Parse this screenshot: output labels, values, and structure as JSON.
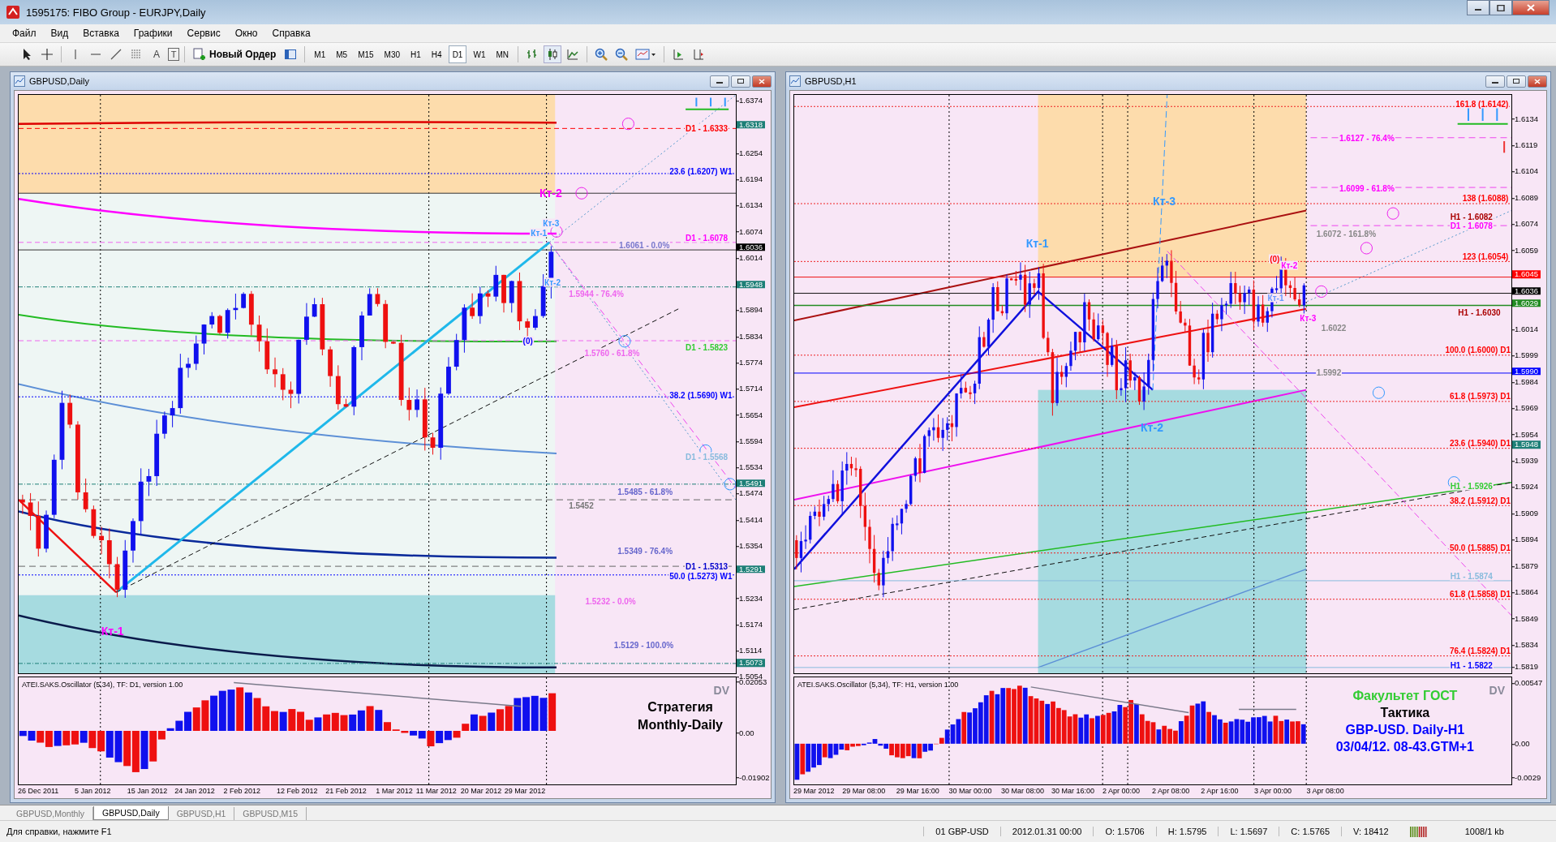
{
  "window": {
    "title": "1595175: FIBO Group - EURJPY,Daily"
  },
  "menu": [
    "Файл",
    "Вид",
    "Вставка",
    "Графики",
    "Сервис",
    "Окно",
    "Справка"
  ],
  "toolbar": {
    "text_tools": [
      "A",
      "T"
    ],
    "new_order": "Новый Ордер",
    "timeframes": [
      {
        "label": "M1",
        "selected": false
      },
      {
        "label": "M5",
        "selected": false
      },
      {
        "label": "M15",
        "selected": false
      },
      {
        "label": "M30",
        "selected": false
      },
      {
        "label": "H1",
        "selected": false
      },
      {
        "label": "H4",
        "selected": false
      },
      {
        "label": "D1",
        "selected": true
      },
      {
        "label": "W1",
        "selected": false
      },
      {
        "label": "MN",
        "selected": false
      }
    ]
  },
  "charts": [
    {
      "title": "GBPUSD,Daily",
      "price_axis": [
        "1.6374",
        "1.6254",
        "1.6194",
        "1.6134",
        "1.6074",
        "1.6014",
        "1.5894",
        "1.5834",
        "1.5774",
        "1.5714",
        "1.5654",
        "1.5594",
        "1.5534",
        "1.5474",
        "1.5414",
        "1.5354",
        "1.5234",
        "1.5174",
        "1.5114",
        "1.5054"
      ],
      "price_tags": [
        {
          "text": "1.6318",
          "color": "#1d7f77"
        },
        {
          "text": "1.6036",
          "color": "#000000"
        },
        {
          "text": "1.5948",
          "color": "#1d7f77"
        },
        {
          "text": "1.5491",
          "color": "#1d7f77"
        },
        {
          "text": "1.5291",
          "color": "#1d7f77"
        },
        {
          "text": "1.5073",
          "color": "#1d7f77"
        }
      ],
      "labels": [
        {
          "text": "D1 - 1.6333",
          "color": "#ff0000",
          "kind": "level"
        },
        {
          "text": "23.6 (1.6207) W1",
          "color": "#0000ff",
          "kind": "level"
        },
        {
          "text": "Кт-2",
          "color": "#ff00ff",
          "kind": "wave"
        },
        {
          "text": "Кт-3",
          "color": "#3399ff",
          "kind": "level"
        },
        {
          "text": "Кт-1",
          "color": "#3399ff",
          "kind": "level"
        },
        {
          "text": "D1 - 1.6078",
          "color": "#ff00ff",
          "kind": "level"
        },
        {
          "text": "1.6061 - 0.0%",
          "color": "#7777cc",
          "kind": "level"
        },
        {
          "text": "Кт-2",
          "color": "#3399ff",
          "kind": "level"
        },
        {
          "text": "1.5944 - 76.4%",
          "color": "#ee66ee",
          "kind": "level"
        },
        {
          "text": "(0)",
          "color": "#0000ff",
          "kind": "level"
        },
        {
          "text": "D1 - 1.5823",
          "color": "#33cc33",
          "kind": "level"
        },
        {
          "text": "1.5760 - 61.8%",
          "color": "#ee66ee",
          "kind": "level"
        },
        {
          "text": "38.2 (1.5690) W1",
          "color": "#0000ff",
          "kind": "level"
        },
        {
          "text": "D1 - 1.5568",
          "color": "#88bbdd",
          "kind": "level"
        },
        {
          "text": "1.5485 - 61.8%",
          "color": "#6666cc",
          "kind": "level"
        },
        {
          "text": "1.5452",
          "color": "#777777",
          "kind": "level"
        },
        {
          "text": "1.5349 - 76.4%",
          "color": "#6666cc",
          "kind": "level"
        },
        {
          "text": "D1 - 1.5313",
          "color": "#0000cc",
          "kind": "level"
        },
        {
          "text": "50.0 (1.5273) W1",
          "color": "#0000ff",
          "kind": "level"
        },
        {
          "text": "1.5232 - 0.0%",
          "color": "#ee66ee",
          "kind": "level"
        },
        {
          "text": "Кт-1",
          "color": "#ff00ff",
          "kind": "wave"
        },
        {
          "text": "1.5129 - 100.0%",
          "color": "#6666cc",
          "kind": "level"
        }
      ],
      "oscillator": {
        "title": "ATEI.SAKS.Oscillator (5,34), TF: D1, version 1.00",
        "badge": "DV",
        "axis": [
          "0.02053",
          "0.00",
          "-0.01902"
        ],
        "notes": [
          {
            "text": "Стратегия",
            "color": "#000000"
          },
          {
            "text": "Monthly-Daily",
            "color": "#000000"
          }
        ]
      },
      "dates": [
        "26 Dec 2011",
        "5 Jan 2012",
        "15 Jan 2012",
        "24 Jan 2012",
        "2 Feb 2012",
        "12 Feb 2012",
        "21 Feb 2012",
        "1 Mar 2012",
        "11 Mar 2012",
        "20 Mar 2012",
        "29 Mar 2012"
      ]
    },
    {
      "title": "GBPUSD,H1",
      "price_axis": [
        "1.6134",
        "1.6119",
        "1.6104",
        "1.6089",
        "1.6074",
        "1.6059",
        "1.6014",
        "1.5999",
        "1.5984",
        "1.5969",
        "1.5954",
        "1.5939",
        "1.5924",
        "1.5909",
        "1.5894",
        "1.5879",
        "1.5864",
        "1.5849",
        "1.5834",
        "1.5819"
      ],
      "price_tags": [
        {
          "text": "1.6045",
          "color": "#ff0000"
        },
        {
          "text": "1.6036",
          "color": "#000000"
        },
        {
          "text": "1.6029",
          "color": "#228b22"
        },
        {
          "text": "1.5990",
          "color": "#0000ff"
        },
        {
          "text": "1.5948",
          "color": "#1d7f77"
        }
      ],
      "labels": [
        {
          "text": "161.8 (1.6142)",
          "color": "#ff0000",
          "kind": "level"
        },
        {
          "text": "1.6127 - 76.4%",
          "color": "#ff00ff",
          "kind": "level"
        },
        {
          "text": "1.6099 - 61.8%",
          "color": "#ff00ff",
          "kind": "level"
        },
        {
          "text": "138 (1.6088)",
          "color": "#ff0000",
          "kind": "level"
        },
        {
          "text": "Кт-3",
          "color": "#3399ff",
          "kind": "wave"
        },
        {
          "text": "H1 - 1.6082",
          "color": "#aa0000",
          "kind": "level"
        },
        {
          "text": "D1 - 1.6078",
          "color": "#ff00ff",
          "kind": "level"
        },
        {
          "text": "1.6072 - 161.8%",
          "color": "#888888",
          "kind": "level"
        },
        {
          "text": "Кт-1",
          "color": "#3399ff",
          "kind": "wave"
        },
        {
          "text": "123 (1.6054)",
          "color": "#ff0000",
          "kind": "level"
        },
        {
          "text": "(0)",
          "color": "#ff0000",
          "kind": "level"
        },
        {
          "text": "Кт-2",
          "color": "#ff00ff",
          "kind": "level"
        },
        {
          "text": "Кт-1",
          "color": "#6699ff",
          "kind": "level"
        },
        {
          "text": "H1 - 1.6030",
          "color": "#aa0000",
          "kind": "level"
        },
        {
          "text": "Кт-3",
          "color": "#ff00ff",
          "kind": "level"
        },
        {
          "text": "1.6022",
          "color": "#888888",
          "kind": "level"
        },
        {
          "text": "100.0 (1.6000) D1",
          "color": "#ff0000",
          "kind": "level"
        },
        {
          "text": "1.5992",
          "color": "#888888",
          "kind": "level"
        },
        {
          "text": "61.8 (1.5973) D1",
          "color": "#ff0000",
          "kind": "level"
        },
        {
          "text": "Кт-2",
          "color": "#3399ff",
          "kind": "wave"
        },
        {
          "text": "23.6 (1.5940) D1",
          "color": "#ff0000",
          "kind": "level"
        },
        {
          "text": "H1 - 1.5926",
          "color": "#33cc33",
          "kind": "level"
        },
        {
          "text": "38.2 (1.5912) D1",
          "color": "#ff0000",
          "kind": "level"
        },
        {
          "text": "50.0 (1.5885) D1",
          "color": "#ff0000",
          "kind": "level"
        },
        {
          "text": "H1 - 1.5874",
          "color": "#88bbdd",
          "kind": "level"
        },
        {
          "text": "61.8 (1.5858) D1",
          "color": "#ff0000",
          "kind": "level"
        },
        {
          "text": "76.4 (1.5824) D1",
          "color": "#ff0000",
          "kind": "level"
        },
        {
          "text": "H1 - 1.5822",
          "color": "#0000ff",
          "kind": "level"
        }
      ],
      "oscillator": {
        "title": "ATEI.SAKS.Oscillator (5,34), TF: H1, version 1.00",
        "badge": "DV",
        "axis": [
          "0.00547",
          "0.00",
          "-0.0029"
        ],
        "notes": [
          {
            "text": "Факультет ГОСТ",
            "color": "#33cc33"
          },
          {
            "text": "Тактика",
            "color": "#000000"
          },
          {
            "text": "GBP-USD. Daily-H1",
            "color": "#0000ff"
          },
          {
            "text": "03/04/12. 08-43.GTM+1",
            "color": "#0000ff"
          }
        ]
      },
      "dates": [
        "29 Mar 2012",
        "29 Mar 08:00",
        "29 Mar 16:00",
        "30 Mar 00:00",
        "30 Mar 08:00",
        "30 Mar 16:00",
        "2 Apr 00:00",
        "2 Apr 08:00",
        "2 Apr 16:00",
        "3 Apr 00:00",
        "3 Apr 08:00"
      ]
    }
  ],
  "tabs": [
    {
      "label": "GBPUSD,Monthly",
      "selected": false
    },
    {
      "label": "GBPUSD,Daily",
      "selected": true
    },
    {
      "label": "GBPUSD,H1",
      "selected": false
    },
    {
      "label": "GBPUSD,M15",
      "selected": false
    }
  ],
  "status_bar": {
    "help": "Для справки, нажмите F1",
    "fields": [
      "01 GBP-USD",
      "2012.01.31 00:00",
      "O: 1.5706",
      "H: 1.5795",
      "L: 1.5697",
      "C: 1.5765",
      "V: 18412"
    ],
    "traffic": "1008/1 kb"
  }
}
